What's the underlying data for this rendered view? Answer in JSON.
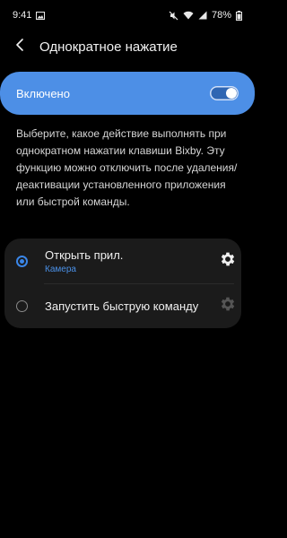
{
  "status_bar": {
    "time": "9:41",
    "battery": "78%"
  },
  "header": {
    "title": "Однократное нажатие"
  },
  "toggle": {
    "label": "Включено",
    "on": true
  },
  "description": "Выберите, какое действие выполнять при однократном нажатии клавиши Bixby. Эту функцию можно отключить после удаления/деактивации установленного приложения или быстрой команды.",
  "options": [
    {
      "title": "Открыть прил.",
      "subtitle": "Камера",
      "selected": true
    },
    {
      "title": "Запустить быструю команду",
      "selected": false
    }
  ],
  "colors": {
    "accent": "#4d8fe6",
    "radio_selected": "#3a86e8",
    "background": "#000000",
    "card": "#1b1b1b"
  }
}
